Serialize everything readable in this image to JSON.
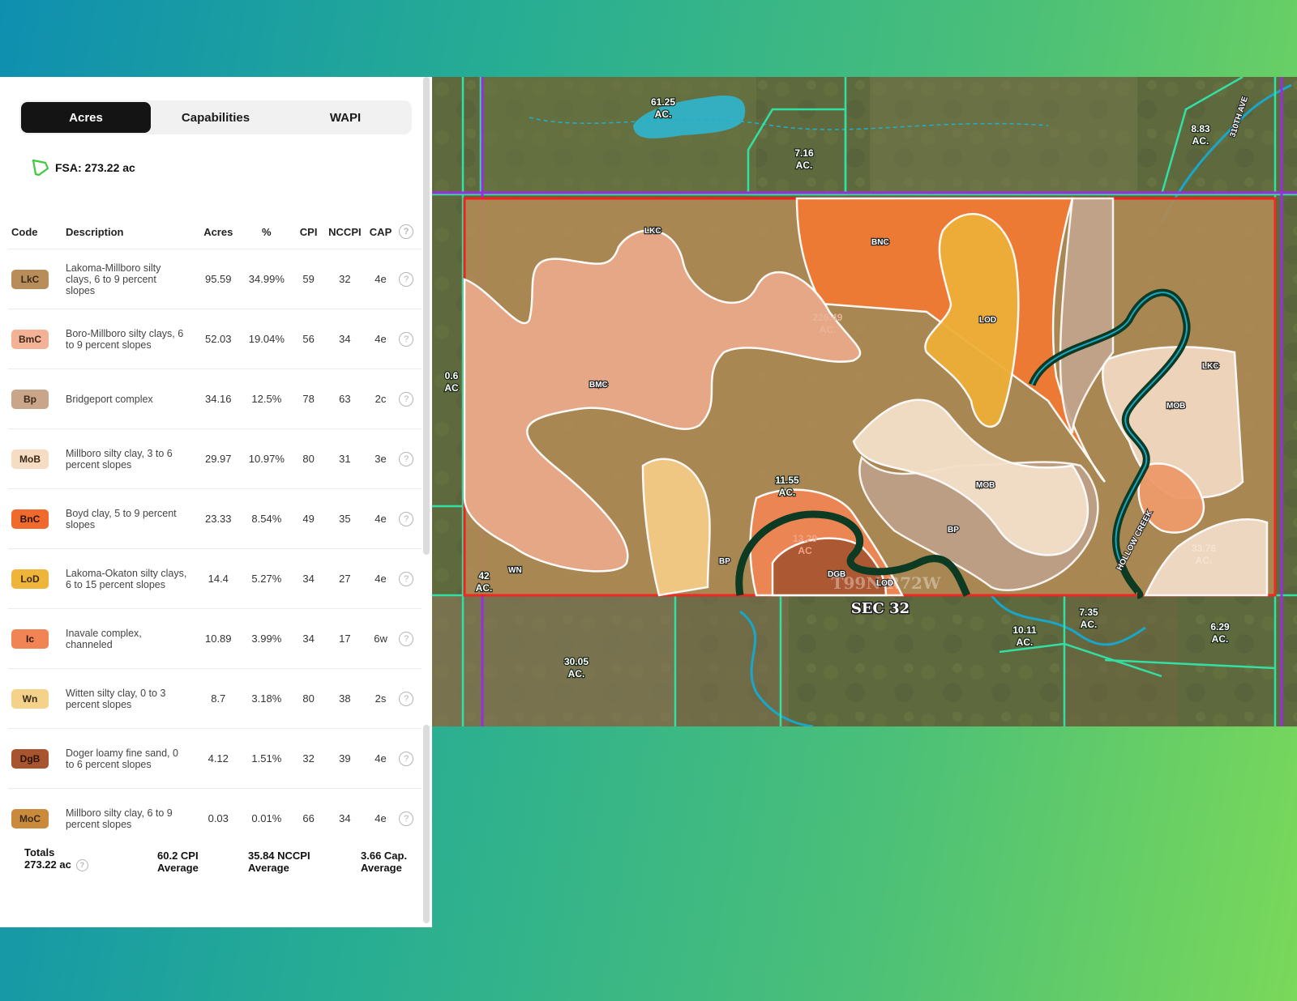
{
  "tabs": [
    {
      "label": "Acres",
      "active": true
    },
    {
      "label": "Capabilities",
      "active": false
    },
    {
      "label": "WAPI",
      "active": false
    }
  ],
  "fsa": {
    "label": "FSA: 273.22 ac",
    "icon": "polygon-icon"
  },
  "table": {
    "headers": {
      "code": "Code",
      "description": "Description",
      "acres": "Acres",
      "pct": "%",
      "cpi": "CPI",
      "nccpi": "NCCPI",
      "cap": "CAP"
    },
    "rows": [
      {
        "code": "LkC",
        "color": "#b88d5a",
        "description": "Lakoma-Millboro silty clays, 6 to 9 percent slopes",
        "acres": "95.59",
        "pct": "34.99%",
        "cpi": "59",
        "nccpi": "32",
        "cap": "4e"
      },
      {
        "code": "BmC",
        "color": "#f3b196",
        "description": "Boro-Millboro silty clays, 6 to 9 percent slopes",
        "acres": "52.03",
        "pct": "19.04%",
        "cpi": "56",
        "nccpi": "34",
        "cap": "4e"
      },
      {
        "code": "Bp",
        "color": "#c9a58a",
        "description": "Bridgeport complex",
        "acres": "34.16",
        "pct": "12.5%",
        "cpi": "78",
        "nccpi": "63",
        "cap": "2c"
      },
      {
        "code": "MoB",
        "color": "#f6dcc3",
        "description": "Millboro silty clay, 3 to 6 percent slopes",
        "acres": "29.97",
        "pct": "10.97%",
        "cpi": "80",
        "nccpi": "31",
        "cap": "3e"
      },
      {
        "code": "BnC",
        "color": "#f06a2e",
        "description": "Boyd clay, 5 to 9 percent slopes",
        "acres": "23.33",
        "pct": "8.54%",
        "cpi": "49",
        "nccpi": "35",
        "cap": "4e"
      },
      {
        "code": "LoD",
        "color": "#efb43a",
        "description": "Lakoma-Okaton silty clays, 6 to 15 percent slopes",
        "acres": "14.4",
        "pct": "5.27%",
        "cpi": "34",
        "nccpi": "27",
        "cap": "4e"
      },
      {
        "code": "Ic",
        "color": "#f08455",
        "description": "Inavale complex, channeled",
        "acres": "10.89",
        "pct": "3.99%",
        "cpi": "34",
        "nccpi": "17",
        "cap": "6w"
      },
      {
        "code": "Wn",
        "color": "#f5d28a",
        "description": "Witten silty clay, 0 to 3 percent slopes",
        "acres": "8.7",
        "pct": "3.18%",
        "cpi": "80",
        "nccpi": "38",
        "cap": "2s"
      },
      {
        "code": "DgB",
        "color": "#a8552f",
        "description": "Doger loamy fine sand, 0 to 6 percent slopes",
        "acres": "4.12",
        "pct": "1.51%",
        "cpi": "32",
        "nccpi": "39",
        "cap": "4e"
      },
      {
        "code": "MoC",
        "color": "#c98a3c",
        "description": "Millboro silty clay, 6 to 9 percent slopes",
        "acres": "0.03",
        "pct": "0.01%",
        "cpi": "66",
        "nccpi": "34",
        "cap": "4e"
      }
    ]
  },
  "totals": {
    "label": "Totals",
    "acres": "273.22 ac",
    "cpi_value": "60.2 CPI",
    "cpi_sub": "Average",
    "nccpi_value": "35.84 NCCPI",
    "nccpi_sub": "Average",
    "cap_value": "3.66 Cap.",
    "cap_sub": "Average"
  },
  "map": {
    "labels": {
      "lkc1": "LKC",
      "bnc": "BNC",
      "lod1": "LOD",
      "bmc": "BMC",
      "lkc2": "LKC",
      "mob1": "MOB",
      "mob2": "MOB",
      "bp1": "BP",
      "bp2": "BP",
      "dgb": "DGB",
      "lod2": "LOD",
      "wn": "WN"
    },
    "acre_labels": {
      "a1_num": "61.25",
      "a1_unit": "AC.",
      "a2_num": "7.16",
      "a2_unit": "AC.",
      "a3_num": "8.83",
      "a3_unit": "AC.",
      "a4_num": "226.49",
      "a4_unit": "AC.",
      "a5_num": "0.6",
      "a5_unit": "AC",
      "a6_num": "11.55",
      "a6_unit": "AC.",
      "a7_num": "13.29",
      "a7_unit": "AC",
      "a8_num": "33.76",
      "a8_unit": "AC.",
      "a9_num": "42",
      "a9_unit": "AC.",
      "a10_num": "30.05",
      "a10_unit": "AC.",
      "a11_num": "10.11",
      "a11_unit": "AC.",
      "a12_num": "7.35",
      "a12_unit": "AC.",
      "a13_num": "6.29",
      "a13_unit": "AC."
    },
    "township": "T99N R72W",
    "section": "SEC 32",
    "road": "310TH AVE",
    "creek": "HOLLOW CREEK"
  }
}
